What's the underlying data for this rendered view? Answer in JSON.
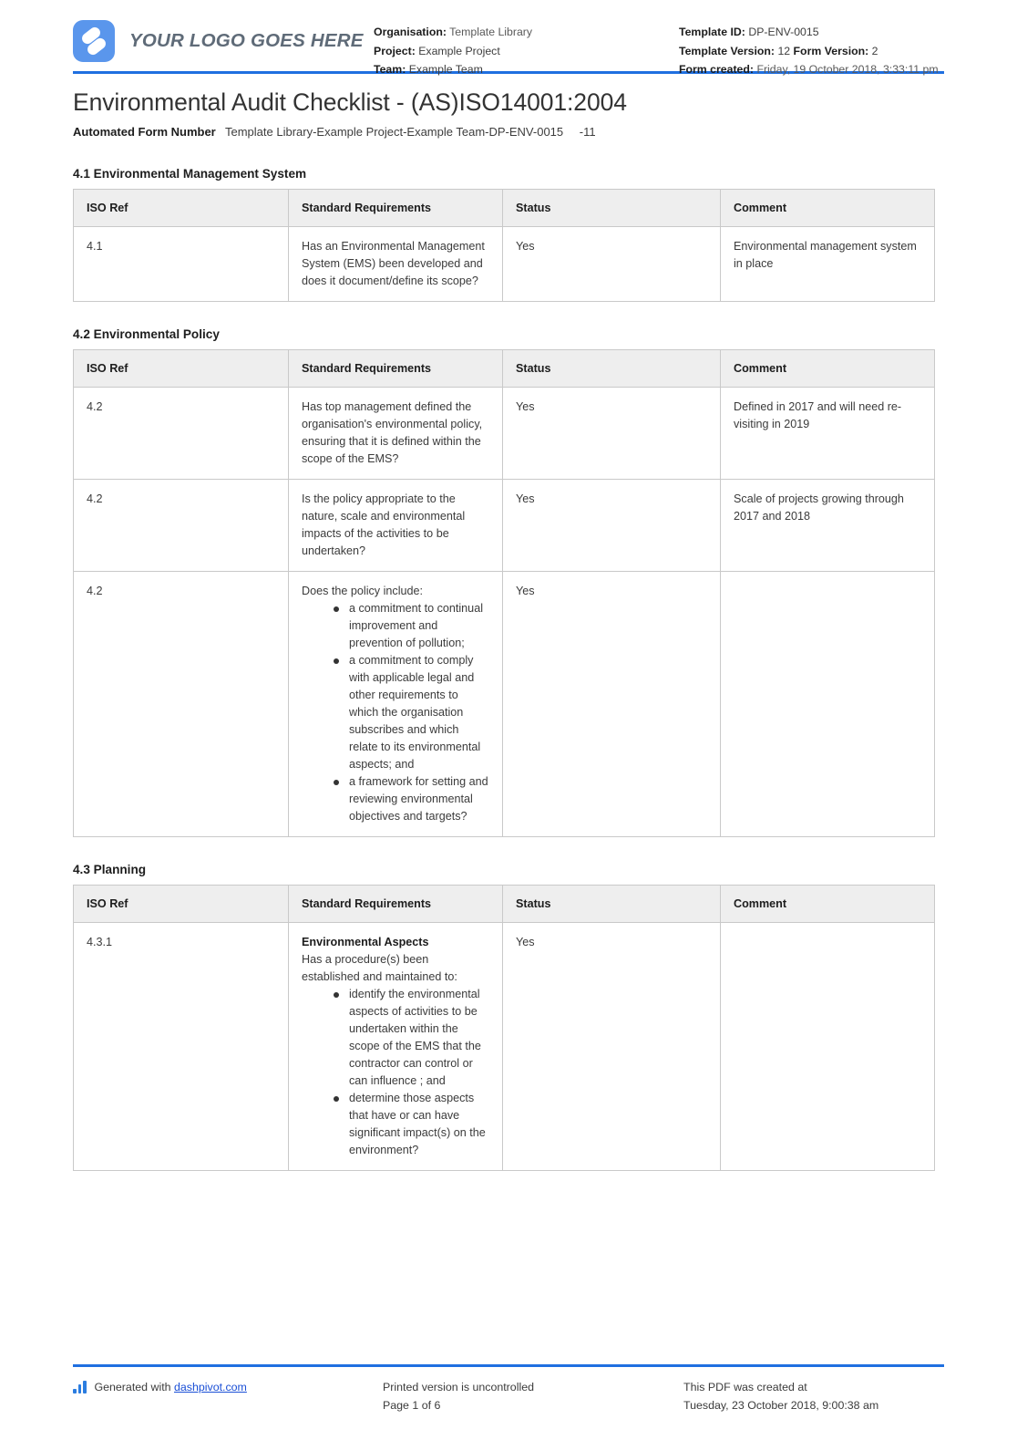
{
  "header": {
    "logo_text": "YOUR LOGO GOES HERE",
    "organisation_label": "Organisation:",
    "organisation_value": "Template Library",
    "project_label": "Project:",
    "project_value": "Example Project",
    "team_label": "Team:",
    "team_value": "Example Team",
    "template_id_label": "Template ID:",
    "template_id_value": "DP-ENV-0015",
    "template_version_label": "Template Version:",
    "template_version_value": "12",
    "form_version_label": "Form Version:",
    "form_version_value": "2",
    "form_created_label": "Form created:",
    "form_created_value": "Friday, 19 October 2018, 3:33:11 pm"
  },
  "title": "Environmental Audit Checklist - (AS)ISO14001:2004",
  "form_number": {
    "label": "Automated Form Number",
    "value": "Template Library-Example Project-Example Team-DP-ENV-0015",
    "suffix": "-11"
  },
  "columns": {
    "iso_ref": "ISO Ref",
    "standard_requirements": "Standard Requirements",
    "status": "Status",
    "comment": "Comment"
  },
  "sections": [
    {
      "title": "4.1 Environmental Management System",
      "rows": [
        {
          "iso_ref": "4.1",
          "requirement": "Has an Environmental Management System (EMS) been developed and does it document/define its scope?",
          "status": "Yes",
          "comment": "Environmental management system in place"
        }
      ]
    },
    {
      "title": "4.2 Environmental Policy",
      "rows": [
        {
          "iso_ref": "4.2",
          "requirement": "Has top management defined the organisation's environmental policy, ensuring that it is defined within the scope of the EMS?",
          "status": "Yes",
          "comment": "Defined in 2017 and will need re-visiting in 2019"
        },
        {
          "iso_ref": "4.2",
          "requirement": "Is the policy appropriate to the nature, scale and environmental impacts of the activities to be undertaken?",
          "status": "Yes",
          "comment": "Scale of projects growing through 2017 and 2018"
        },
        {
          "iso_ref": "4.2",
          "requirement_intro": "Does the policy include:",
          "requirement_bullets": [
            "a commitment to continual improvement and prevention of pollution;",
            "a commitment to comply with applicable legal and other requirements to which the organisation subscribes and which relate to its environmental aspects; and",
            "a framework for setting and reviewing environmental objectives and targets?"
          ],
          "status": "Yes",
          "comment": ""
        }
      ]
    },
    {
      "title": "4.3 Planning",
      "rows": [
        {
          "iso_ref": "4.3.1",
          "requirement_heading": "Environmental Aspects",
          "requirement_intro": "Has a procedure(s) been established and maintained to:",
          "requirement_bullets": [
            "identify the environmental aspects of activities to be undertaken within the scope of the EMS that the contractor can control or can influence ; and",
            "determine those aspects that have or can have significant impact(s) on the environment?"
          ],
          "status": "Yes",
          "comment": ""
        }
      ]
    }
  ],
  "footer": {
    "generated_prefix": "Generated with ",
    "generated_link": "dashpivot.com",
    "printed_notice": "Printed version is uncontrolled",
    "page_indicator": "Page 1 of 6",
    "created_label": "This PDF was created at",
    "created_value": "Tuesday, 23 October 2018, 9:00:38 am"
  },
  "colors": {
    "accent_blue": "#1f6fe0",
    "logo_blue": "#5a96ec",
    "table_header_bg": "#eeeeee",
    "link_blue": "#1a4fd6"
  }
}
